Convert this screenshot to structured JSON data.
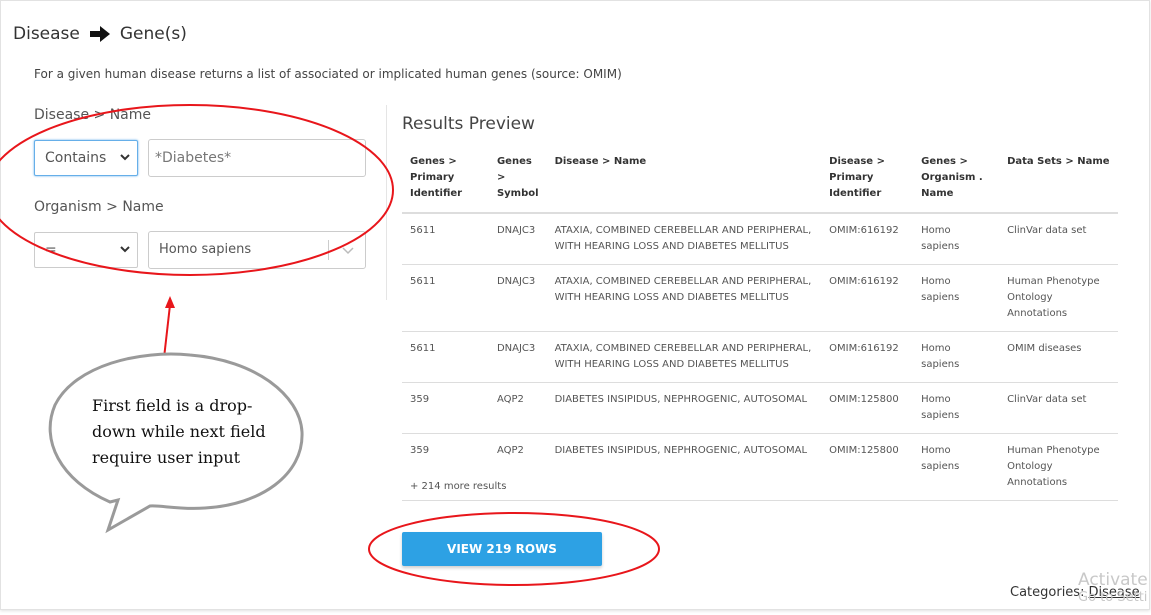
{
  "header": {
    "from": "Disease",
    "to": "Gene(s)",
    "description": "For a given human disease returns a list of associated or implicated human genes (source: OMIM)"
  },
  "constraints": {
    "disease": {
      "label": "Disease > Name",
      "operator": "Contains",
      "value": "*Diabetes*"
    },
    "organism": {
      "label": "Organism > Name",
      "operator": "=",
      "value": "Homo sapiens"
    }
  },
  "results": {
    "title": "Results Preview",
    "columns": [
      "Genes > Primary Identifier",
      "Genes > Symbol",
      "Disease > Name",
      "Disease > Primary Identifier",
      "Genes > Organism . Name",
      "Data Sets > Name"
    ],
    "rows": [
      [
        "5611",
        "DNAJC3",
        "ATAXIA, COMBINED CEREBELLAR AND PERIPHERAL, WITH HEARING LOSS AND DIABETES MELLITUS",
        "OMIM:616192",
        "Homo sapiens",
        "ClinVar data set"
      ],
      [
        "5611",
        "DNAJC3",
        "ATAXIA, COMBINED CEREBELLAR AND PERIPHERAL, WITH HEARING LOSS AND DIABETES MELLITUS",
        "OMIM:616192",
        "Homo sapiens",
        "Human Phenotype Ontology Annotations"
      ],
      [
        "5611",
        "DNAJC3",
        "ATAXIA, COMBINED CEREBELLAR AND PERIPHERAL, WITH HEARING LOSS AND DIABETES MELLITUS",
        "OMIM:616192",
        "Homo sapiens",
        "OMIM diseases"
      ],
      [
        "359",
        "AQP2",
        "DIABETES INSIPIDUS, NEPHROGENIC, AUTOSOMAL",
        "OMIM:125800",
        "Homo sapiens",
        "ClinVar data set"
      ],
      [
        "359",
        "AQP2",
        "DIABETES INSIPIDUS, NEPHROGENIC, AUTOSOMAL",
        "OMIM:125800",
        "Homo sapiens",
        "Human Phenotype Ontology Annotations"
      ]
    ],
    "more": "+ 214 more results",
    "view_button": "VIEW 219 ROWS"
  },
  "footer": {
    "categories_label": "Categories:",
    "categories_value": "Disease"
  },
  "watermark": {
    "line1": "Activate",
    "line2": "Go to Setti"
  },
  "annotation": {
    "callout": "First field is a drop-down while next field require user input",
    "color": "#e8161b"
  },
  "colors": {
    "button": "#2da1e4",
    "annotation": "#e8161b"
  }
}
